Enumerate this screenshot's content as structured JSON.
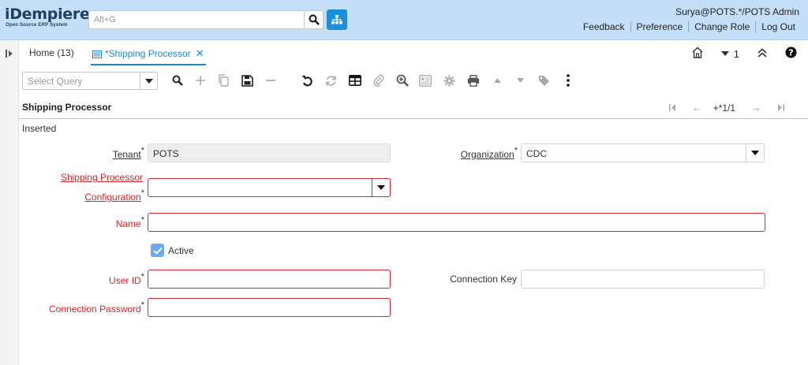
{
  "header": {
    "logo_main": "iDempiere",
    "logo_sub": "Open Source ERP System",
    "search_placeholder": "Alt+G",
    "user": "Surya@POTS.*/POTS Admin",
    "links": [
      "Feedback",
      "Preference",
      "Change Role",
      "Log Out"
    ]
  },
  "tabs": {
    "home": "Home (13)",
    "active": "*Shipping Processor",
    "window_count": "1"
  },
  "toolbar": {
    "query_placeholder": "Select Query"
  },
  "window": {
    "title": "Shipping Processor",
    "record_nav": "+*1/1",
    "status": "Inserted"
  },
  "form": {
    "tenant_label": "Tenant",
    "tenant_value": "POTS",
    "organization_label": "Organization",
    "organization_value": "CDC",
    "config_label_line1": "Shipping Processor",
    "config_label_line2": "Configuration",
    "config_value": "",
    "name_label": "Name",
    "name_value": "",
    "active_label": "Active",
    "active_checked": true,
    "userid_label": "User ID",
    "userid_value": "",
    "connkey_label": "Connection Key",
    "connkey_value": "",
    "connpwd_label": "Connection Password",
    "connpwd_value": "",
    "required_mark": "*"
  },
  "colors": {
    "header_bg": "#c5dff8",
    "accent": "#1a8ad6",
    "required": "#d8262e",
    "checkbox": "#6aabf0"
  }
}
